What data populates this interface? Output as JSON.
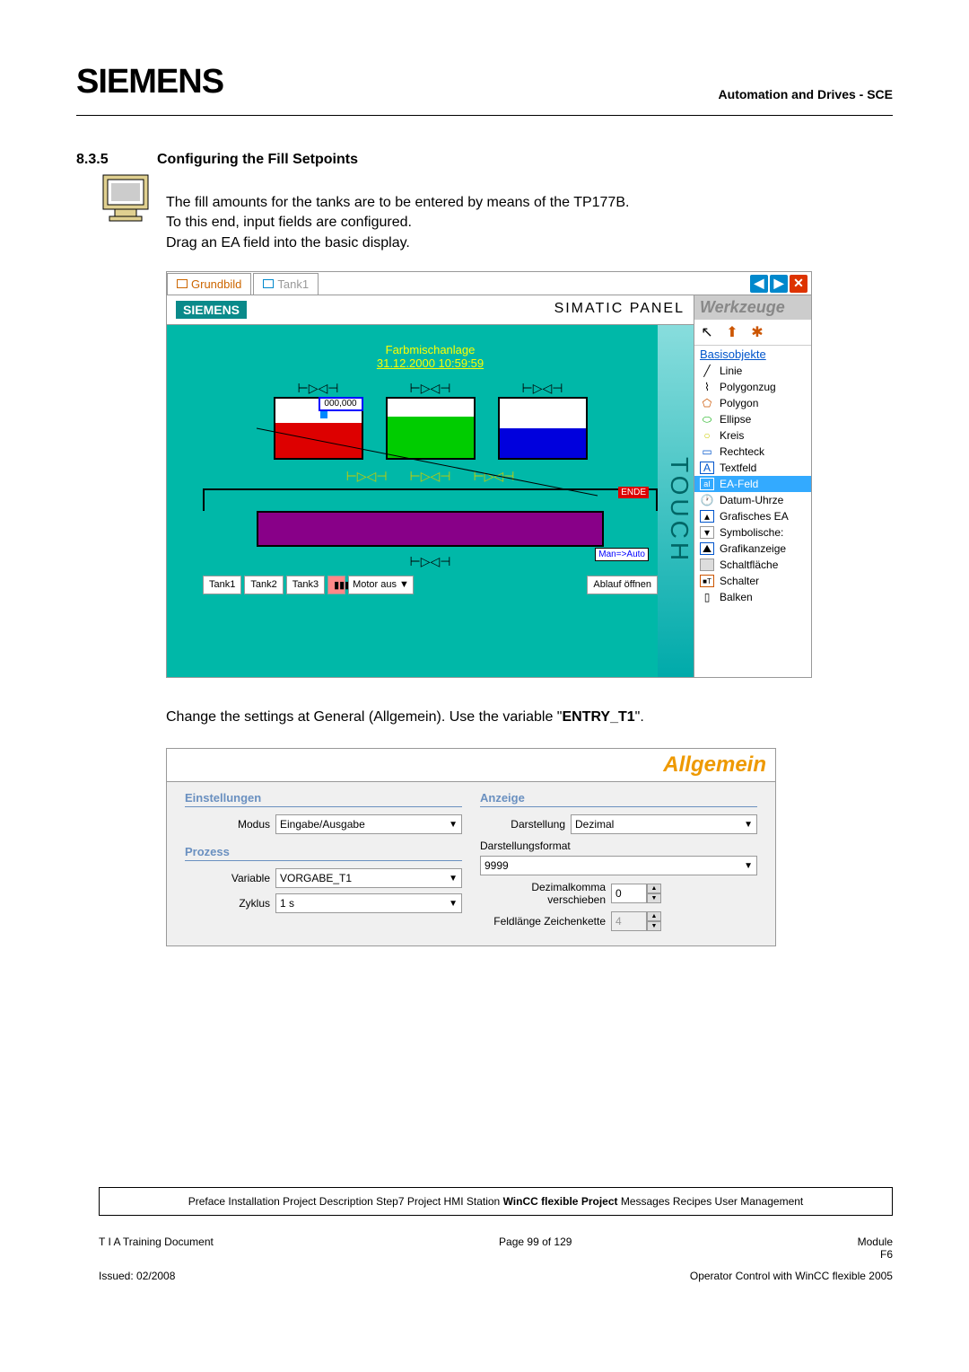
{
  "header": {
    "logo": "SIEMENS",
    "right": "Automation and Drives - SCE"
  },
  "section": {
    "number": "8.3.5",
    "title": "Configuring the Fill Setpoints"
  },
  "intro_p1": "The fill amounts for the tanks are to be entered by means of the TP177B.",
  "intro_p2": "To this end, input fields are configured.",
  "intro_p3": "Drag an EA field into the basic display.",
  "wincc": {
    "tabs": [
      "Grundbild",
      "Tank1"
    ],
    "siemens_bar_logo": "SIEMENS",
    "simatic_text": "SIMATIC PANEL",
    "touch": "TOUCH",
    "plant_title": "Farbmischanlage",
    "plant_date": "31.12.2000 10:59:59",
    "tank_input": "000,000",
    "ende": "ENDE",
    "man_auto": "Man=>Auto",
    "bottom_buttons": [
      "Tank1",
      "Tank2",
      "Tank3"
    ],
    "motor_select": "Motor aus",
    "ablauf": "Ablauf öffnen"
  },
  "werkzeuge": {
    "title": "Werkzeuge",
    "section": "Basisobjekte",
    "items": [
      {
        "label": "Linie"
      },
      {
        "label": "Polygonzug"
      },
      {
        "label": "Polygon"
      },
      {
        "label": "Ellipse"
      },
      {
        "label": "Kreis"
      },
      {
        "label": "Rechteck"
      },
      {
        "label": "Textfeld"
      },
      {
        "label": "EA-Feld"
      },
      {
        "label": "Datum-Uhrze"
      },
      {
        "label": "Grafisches EA"
      },
      {
        "label": "Symbolische:"
      },
      {
        "label": "Grafikanzeige"
      },
      {
        "label": "Schaltfläche"
      },
      {
        "label": "Schalter"
      },
      {
        "label": "Balken"
      }
    ]
  },
  "text2_pre": "Change the settings at General (Allgemein). Use the variable \"",
  "text2_bold": "ENTRY_T1",
  "text2_post": "\".",
  "allgemein": {
    "title": "Allgemein",
    "einstellungen": "Einstellungen",
    "modus_label": "Modus",
    "modus_value": "Eingabe/Ausgabe",
    "prozess": "Prozess",
    "variable_label": "Variable",
    "variable_value": "VORGABE_T1",
    "zyklus_label": "Zyklus",
    "zyklus_value": "1 s",
    "anzeige": "Anzeige",
    "darstellung_label": "Darstellung",
    "darstellung_value": "Dezimal",
    "format": "Darstellungsformat",
    "format_value": "9999",
    "dezimal_label": "Dezimalkomma verschieben",
    "dezimal_value": "0",
    "feldlange_label": "Feldlänge Zeichenkette",
    "feldlange_value": "4"
  },
  "footer": {
    "nav_pre": "Preface Installation Project Description Step7 Project HMI Station ",
    "nav_bold": "WinCC flexible Project",
    "nav_post": " Messages Recipes User Management",
    "left1": "T I A  Training Document",
    "center1": "Page 99 of 129",
    "right1": "Module",
    "right1b": "F6",
    "left2": "Issued: 02/2008",
    "right2": "Operator Control with WinCC flexible 2005"
  }
}
